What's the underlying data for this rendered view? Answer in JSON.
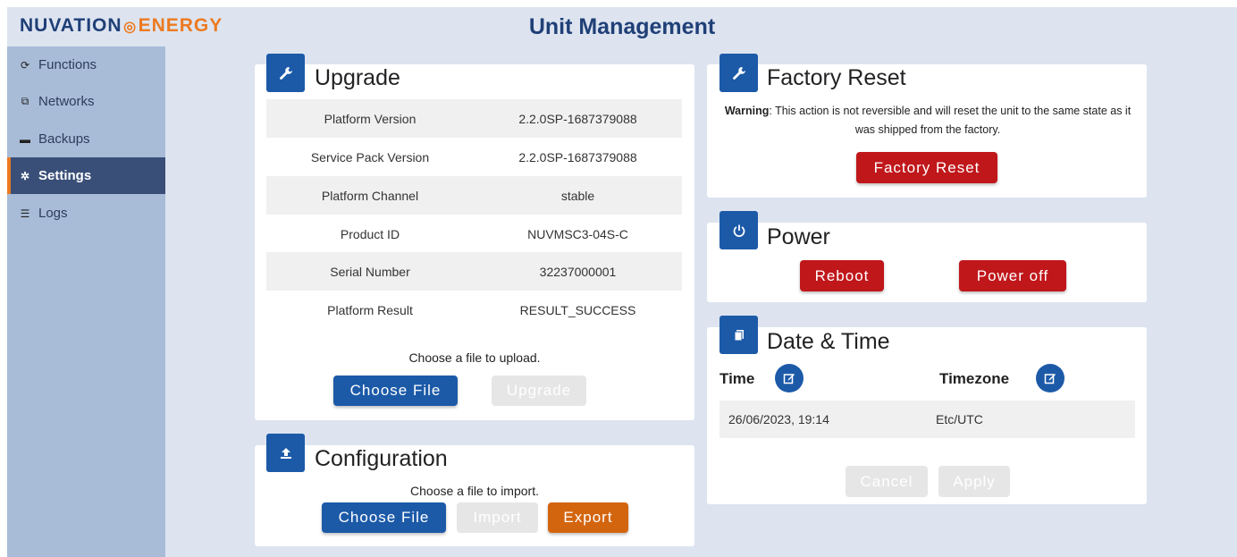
{
  "brand": {
    "part1": "NUVATION",
    "sep": "◎",
    "part2": "ENERGY"
  },
  "page_title": "Unit Management",
  "sidebar": {
    "items": [
      {
        "label": "Functions",
        "icon": "refresh-icon",
        "glyph": "⟳"
      },
      {
        "label": "Networks",
        "icon": "network-icon",
        "glyph": "⧉"
      },
      {
        "label": "Backups",
        "icon": "drive-icon",
        "glyph": "▬"
      },
      {
        "label": "Settings",
        "icon": "gear-icon",
        "glyph": "✲"
      },
      {
        "label": "Logs",
        "icon": "list-icon",
        "glyph": "☰"
      }
    ],
    "active": "Settings"
  },
  "upgrade": {
    "title": "Upgrade",
    "rows": [
      {
        "label": "Platform Version",
        "value": "2.2.0SP-1687379088"
      },
      {
        "label": "Service Pack Version",
        "value": "2.2.0SP-1687379088"
      },
      {
        "label": "Platform Channel",
        "value": "stable"
      },
      {
        "label": "Product ID",
        "value": "NUVMSC3-04S-C"
      },
      {
        "label": "Serial Number",
        "value": "32237000001"
      },
      {
        "label": "Platform Result",
        "value": "RESULT_SUCCESS"
      }
    ],
    "prompt": "Choose a file to upload.",
    "choose_file": "Choose File",
    "upgrade_btn": "Upgrade"
  },
  "configuration": {
    "title": "Configuration",
    "prompt": "Choose a file to import.",
    "choose_file": "Choose File",
    "import_btn": "Import",
    "export_btn": "Export"
  },
  "factory_reset": {
    "title": "Factory Reset",
    "warning_label": "Warning",
    "warning_text": ": This action is not reversible and will reset the unit to the same state as it was shipped from the factory.",
    "button": "Factory Reset"
  },
  "power": {
    "title": "Power",
    "reboot": "Reboot",
    "power_off": "Power off"
  },
  "datetime": {
    "title": "Date & Time",
    "time_label": "Time",
    "timezone_label": "Timezone",
    "time_value": "26/06/2023, 19:14",
    "timezone_value": "Etc/UTC",
    "cancel": "Cancel",
    "apply": "Apply"
  },
  "colors": {
    "primary": "#1c5aa8",
    "danger": "#c0171b",
    "accent": "#d4650f",
    "sidebar_bg": "#a8bcd8",
    "sidebar_active": "#3a4f78"
  }
}
